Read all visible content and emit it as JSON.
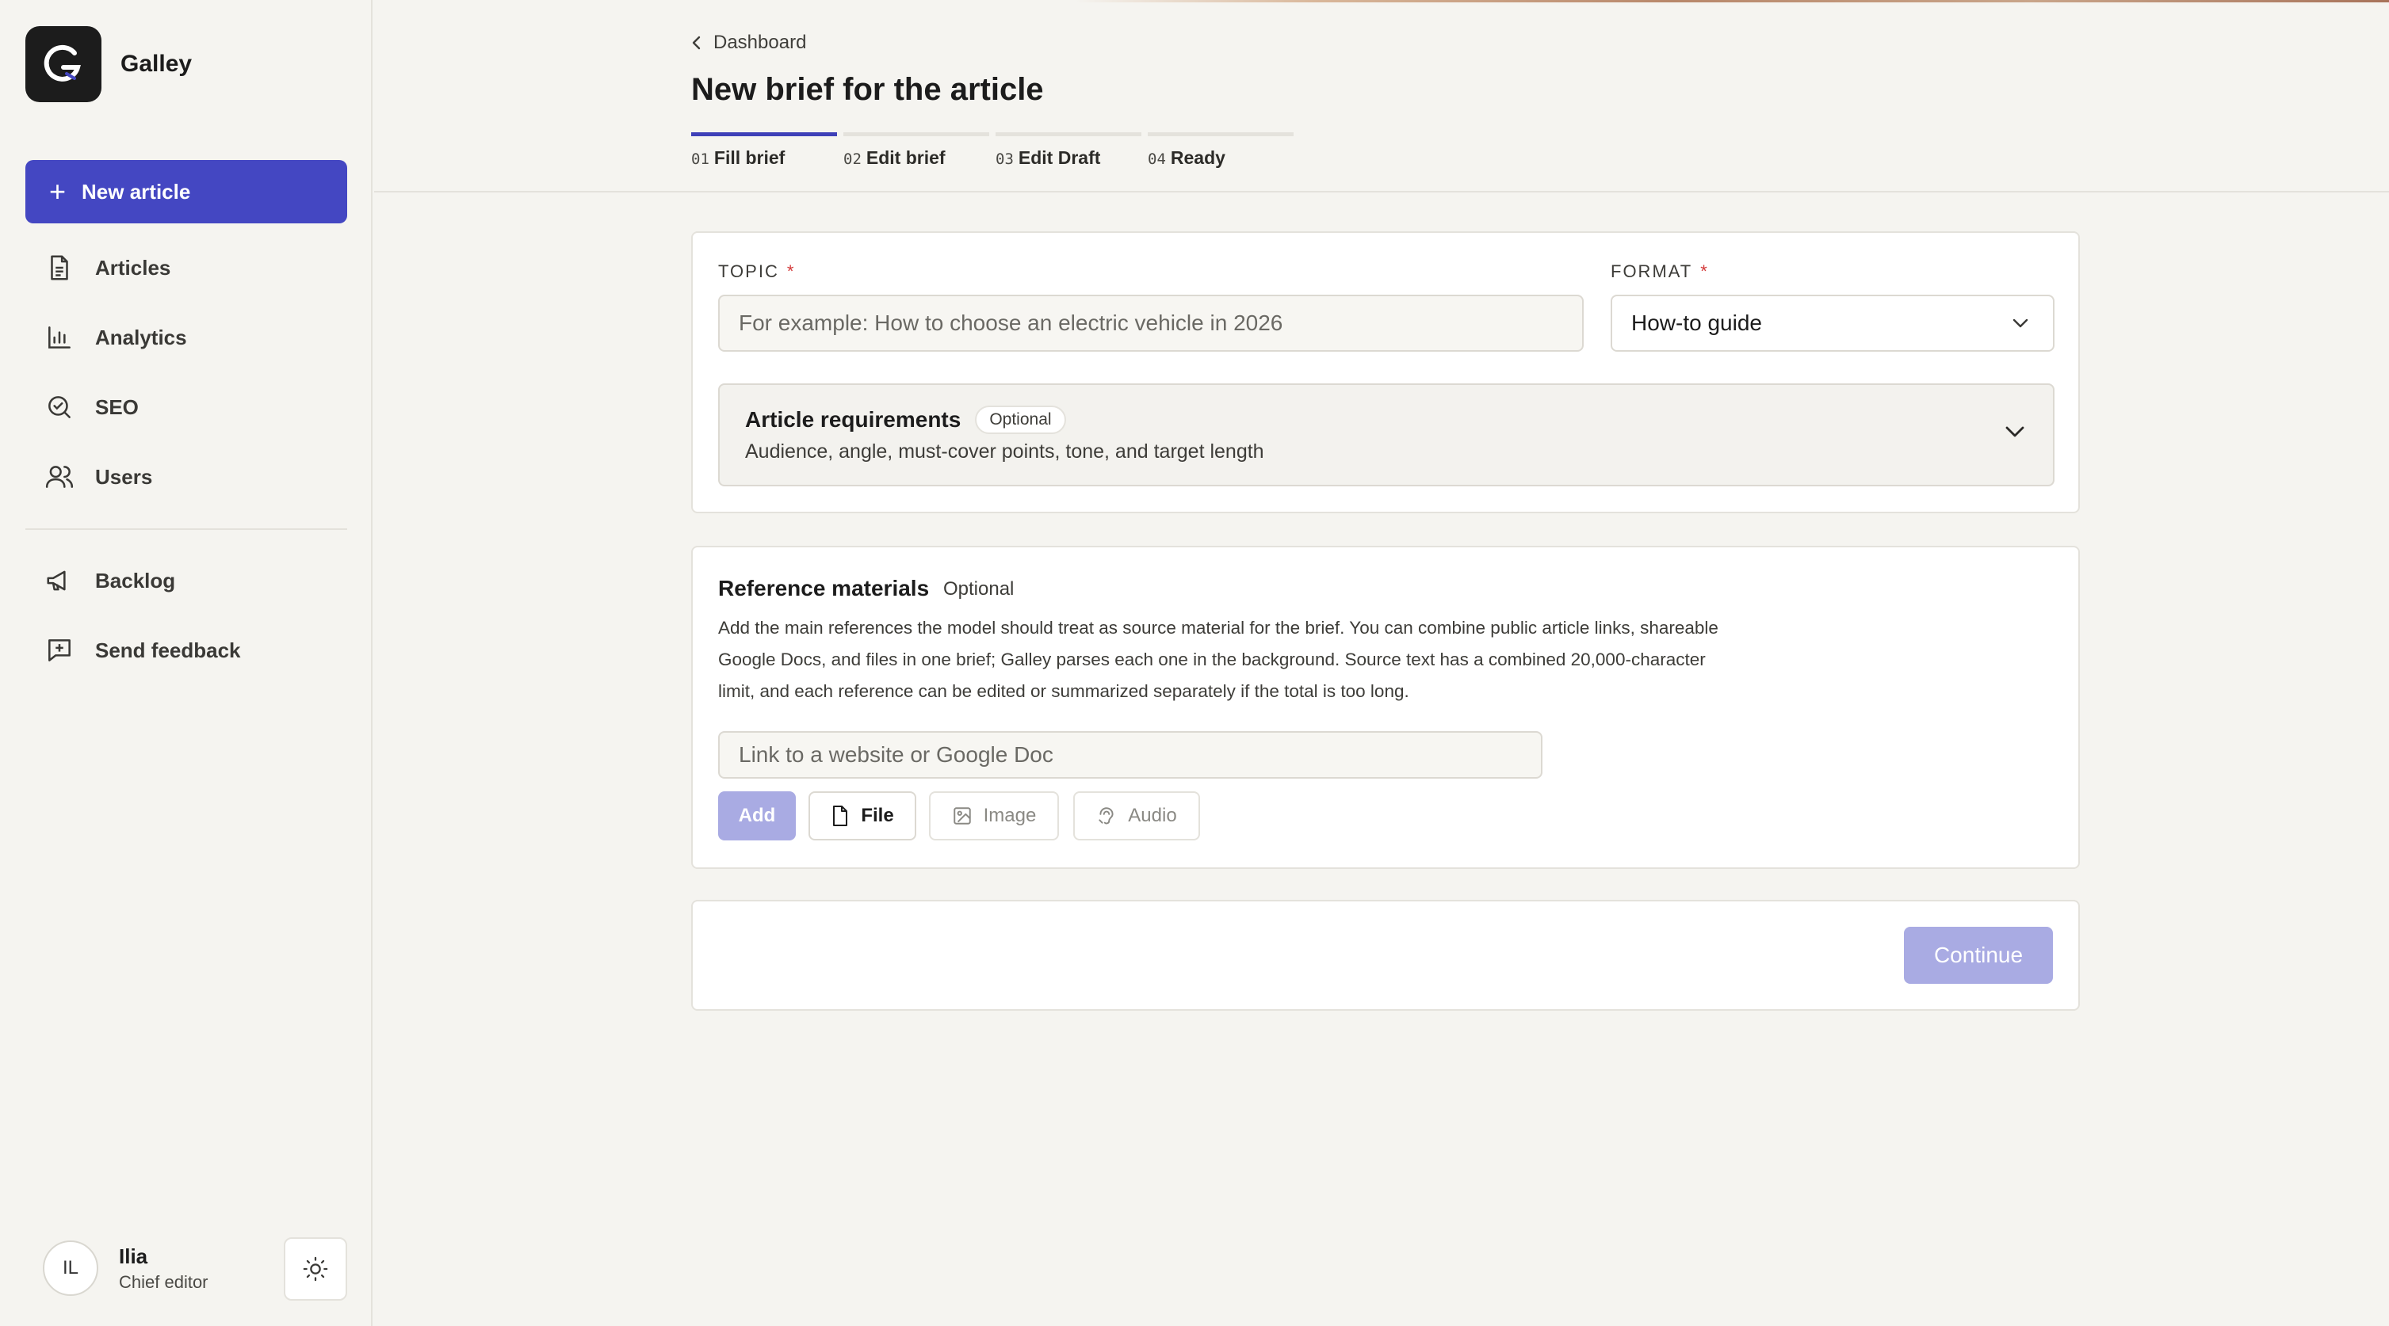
{
  "brand": {
    "name": "Galley",
    "logo_letter": "G"
  },
  "sidebar": {
    "new_article": "New article",
    "items": [
      {
        "label": "Articles",
        "icon": "document-icon"
      },
      {
        "label": "Analytics",
        "icon": "bar-chart-icon"
      },
      {
        "label": "SEO",
        "icon": "search-check-icon"
      },
      {
        "label": "Users",
        "icon": "users-icon"
      },
      {
        "label": "Backlog",
        "icon": "megaphone-icon"
      },
      {
        "label": "Send feedback",
        "icon": "message-plus-icon"
      }
    ],
    "user": {
      "initials": "IL",
      "name": "Ilia",
      "role": "Chief editor"
    }
  },
  "header": {
    "breadcrumb": "Dashboard",
    "title": "New brief for the article",
    "steps": [
      {
        "num": "01",
        "label": "Fill brief",
        "active": true
      },
      {
        "num": "02",
        "label": "Edit brief",
        "active": false
      },
      {
        "num": "03",
        "label": "Edit Draft",
        "active": false
      },
      {
        "num": "04",
        "label": "Ready",
        "active": false
      }
    ]
  },
  "topic": {
    "label": "TOPIC",
    "required_mark": "*",
    "placeholder": "For example: How to choose an electric vehicle in 2026"
  },
  "format": {
    "label": "FORMAT",
    "required_mark": "*",
    "value": "How-to guide"
  },
  "requirements": {
    "title": "Article requirements",
    "badge": "Optional",
    "subtitle": "Audience, angle, must-cover points, tone, and target length"
  },
  "references": {
    "title": "Reference materials",
    "optional": "Optional",
    "description": "Add the main references the model should treat as source material for the brief. You can combine public article links, shareable Google Docs, and files in one brief; Galley parses each one in the background. Source text has a combined 20,000-character limit, and each reference can be edited or summarized separately if the total is too long.",
    "link_placeholder": "Link to a website or Google Doc",
    "buttons": {
      "add": "Add",
      "file": "File",
      "image": "Image",
      "audio": "Audio"
    }
  },
  "footer": {
    "continue": "Continue"
  },
  "colors": {
    "accent": "#4447c2",
    "accent_disabled": "#a9abe3",
    "required": "#d33a3a"
  }
}
